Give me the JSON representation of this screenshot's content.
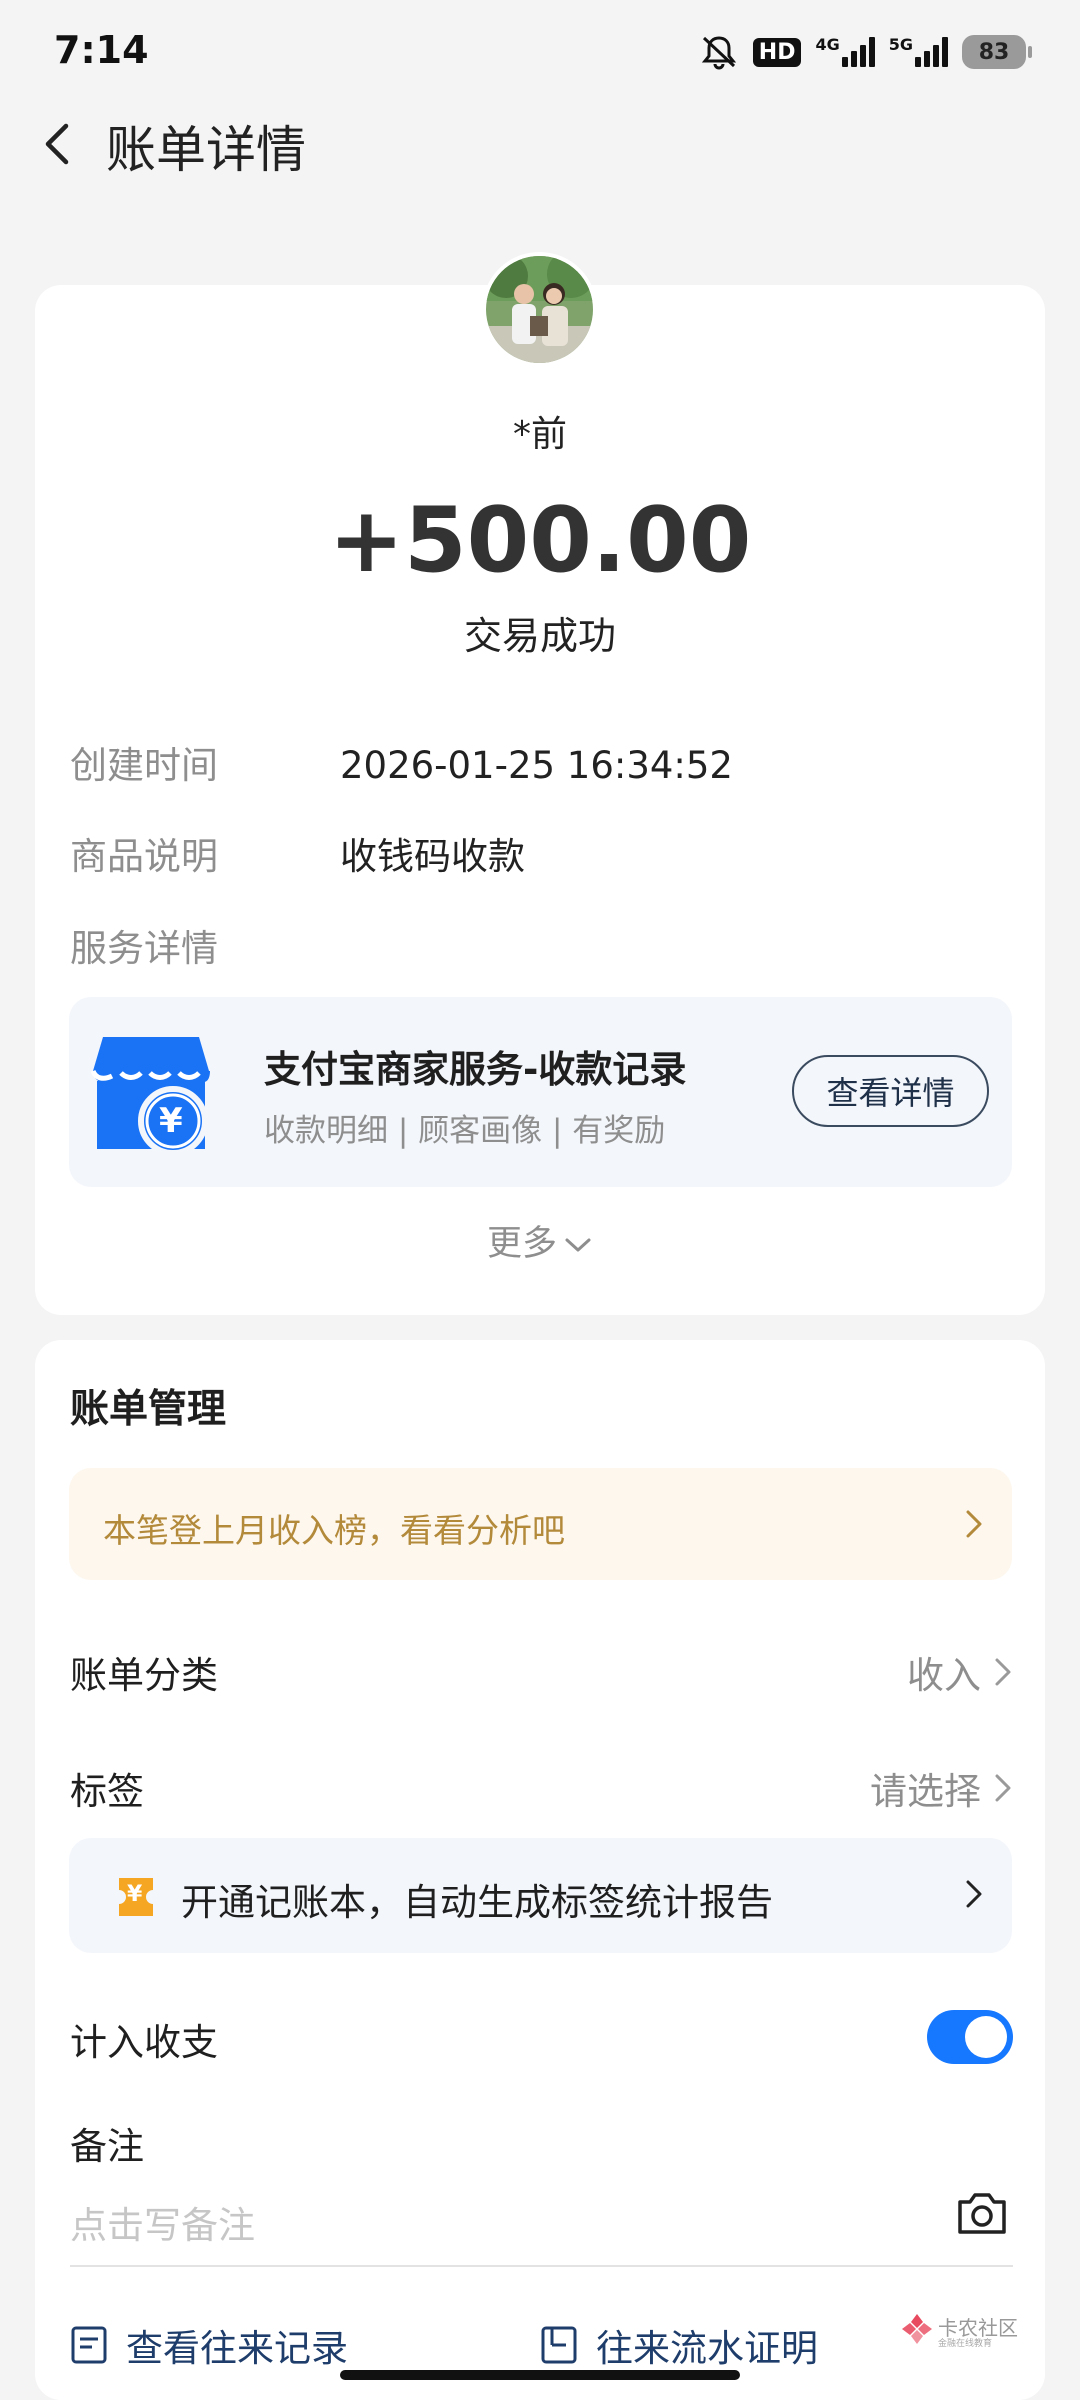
{
  "status": {
    "time": "7:14",
    "network_hd": "HD",
    "net1": "4G",
    "net2": "5G",
    "battery": "83"
  },
  "nav": {
    "title": "账单详情",
    "back_icon": "chevron-left-icon"
  },
  "transaction": {
    "payer": "*前",
    "amount": "+500.00",
    "state": "交易成功"
  },
  "details": [
    {
      "label": "创建时间",
      "value": "2026-01-25 16:34:52"
    },
    {
      "label": "商品说明",
      "value": "收钱码收款"
    },
    {
      "label": "服务详情",
      "value": ""
    }
  ],
  "service": {
    "title": "支付宝商家服务-收款记录",
    "subtitle": "收款明细 | 顾客画像 | 有奖励",
    "button": "查看详情",
    "logo_symbol": "¥"
  },
  "more": {
    "label": "更多"
  },
  "management": {
    "title": "账单管理",
    "tip": "本笔登上月收入榜，看看分析吧",
    "category_label": "账单分类",
    "category_value": "收入",
    "tag_label": "标签",
    "tag_value": "请选择",
    "promo_icon_symbol": "¥",
    "promo_text": "开通记账本，自动生成标签统计报告",
    "include_label": "计入收支",
    "include_enabled": true,
    "note_label": "备注",
    "note_placeholder": "点击写备注"
  },
  "bottom": {
    "records": "查看往来记录",
    "proof": "往来流水证明"
  },
  "watermark": {
    "title": "卡农社区",
    "subtitle": "金融在线教育"
  },
  "colors": {
    "accent": "#1677ff",
    "tip_text": "#b3893a",
    "link": "#1f3d6b"
  }
}
